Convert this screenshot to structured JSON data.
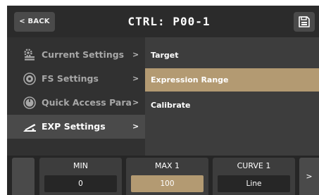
{
  "header": {
    "back_label": "< BACK",
    "title": "CTRL: P00-1",
    "save_icon": "save-icon"
  },
  "menu": {
    "items": [
      {
        "label": "Current Settings",
        "icon": "settings-gear-icon",
        "arrow": ">",
        "active": false
      },
      {
        "label": "FS Settings",
        "icon": "footswitch-icon",
        "arrow": ">",
        "active": false
      },
      {
        "label": "Quick Access Para",
        "icon": "knob-icon",
        "arrow": ">",
        "active": false
      },
      {
        "label": "EXP Settings",
        "icon": "expression-pedal-icon",
        "arrow": ">",
        "active": true
      }
    ]
  },
  "panel": {
    "options": [
      {
        "label": "Target",
        "selected": false
      },
      {
        "label": "Expression Range",
        "selected": true
      },
      {
        "label": "Calibrate",
        "selected": false
      }
    ]
  },
  "params": [
    {
      "label": "MIN",
      "value": "0",
      "selected": false
    },
    {
      "label": "MAX 1",
      "value": "100",
      "selected": true
    },
    {
      "label": "CURVE 1",
      "value": "Line",
      "selected": false
    }
  ],
  "bottom": {
    "next_label": ">"
  },
  "colors": {
    "accent": "#b39a72",
    "background": "#171717",
    "menu_bg": "#313131",
    "panel_bg": "#3d3d3d",
    "button_bg": "#4a4a4a"
  }
}
